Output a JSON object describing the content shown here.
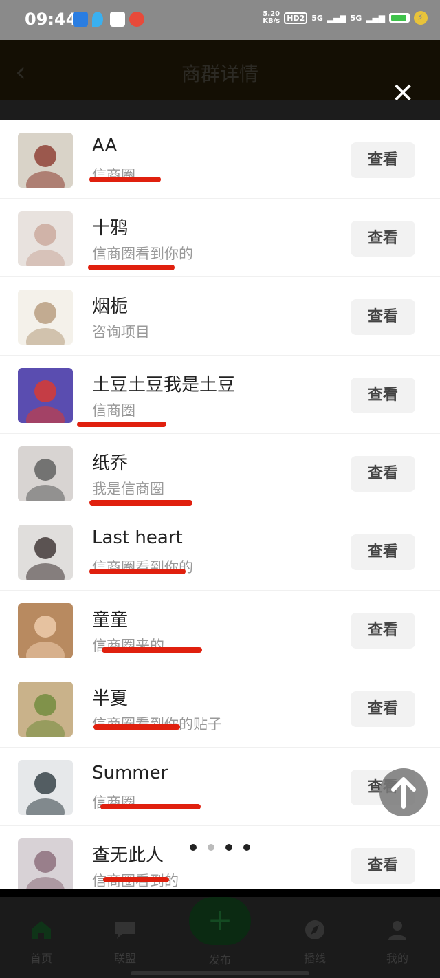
{
  "status_bar": {
    "time": "09:44",
    "net_speed": "5.20\nKB/s",
    "hd_badge": "HD2",
    "signal_1": "5G",
    "signal_2": "5G",
    "icons": [
      "message-icon",
      "droplet-icon",
      "app-icon",
      "game-icon"
    ]
  },
  "header": {
    "title": "商群详情",
    "back_icon": "back-icon",
    "close_icon": "close-icon"
  },
  "list": {
    "button_label": "查看",
    "items": [
      {
        "name": "AA",
        "subtitle": "信商圈",
        "underlined": true
      },
      {
        "name": "十鸦",
        "subtitle": "信商圈看到你的",
        "underlined": true
      },
      {
        "name": "烟栀",
        "subtitle": "咨询项目",
        "underlined": false
      },
      {
        "name": "土豆土豆我是土豆",
        "subtitle": "信商圈",
        "underlined": true
      },
      {
        "name": "纸乔",
        "subtitle": "我是信商圈",
        "underlined": true
      },
      {
        "name": "Last heart",
        "subtitle": "信商圈看到你的",
        "underlined": true
      },
      {
        "name": "童童",
        "subtitle": "信商圈来的",
        "underlined": true
      },
      {
        "name": "半夏",
        "subtitle": "信商圈看到你的贴子",
        "underlined": true
      },
      {
        "name": "Summer",
        "subtitle": "信商圈",
        "underlined": true
      },
      {
        "name": "查无此人",
        "subtitle": "信商圈看到的",
        "underlined": true
      }
    ]
  },
  "accent_color": "#e0200e",
  "bottom_nav": {
    "items": [
      {
        "label": "首页",
        "icon": "home-icon"
      },
      {
        "label": "联盟",
        "icon": "chat-icon"
      },
      {
        "label": "发布",
        "icon": "plus-icon"
      },
      {
        "label": "播线",
        "icon": "compass-icon"
      },
      {
        "label": "我的",
        "icon": "user-icon"
      }
    ]
  }
}
